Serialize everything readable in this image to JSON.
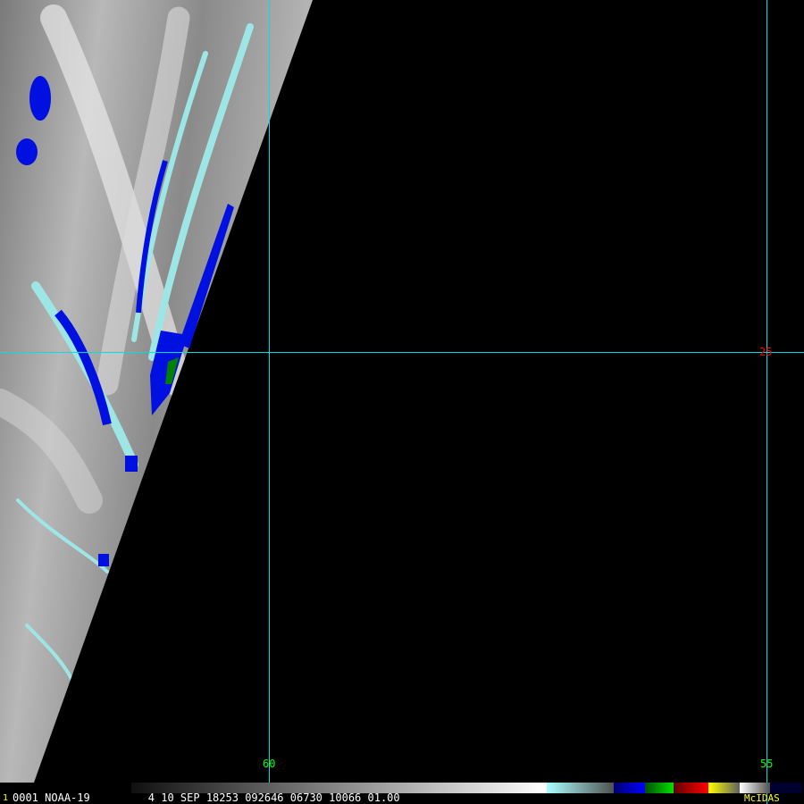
{
  "image": {
    "type": "satellite-imagery",
    "satellite": "NOAA-19",
    "frame_number": "1",
    "header_fields": [
      "0001",
      "NOAA-19",
      "4",
      "10",
      "SEP",
      "18253",
      "092646",
      "06730",
      "10066",
      "01.00"
    ],
    "software": "McIDAS"
  },
  "grid": {
    "longitude_labels": [
      "60",
      "55"
    ],
    "latitude_labels": [
      "25"
    ],
    "grid_color": "#00e0e0",
    "lon_label_color": "#00ff00",
    "lat_label_color": "#ff0000"
  },
  "colorbar": {
    "segments": [
      {
        "name": "gray-ramp",
        "colors": [
          "#101010",
          "#ffffff"
        ]
      },
      {
        "name": "cyan-ramp",
        "colors": [
          "#aaffff",
          "#505050"
        ]
      },
      {
        "name": "blue",
        "colors": [
          "#000070",
          "#0000ff"
        ]
      },
      {
        "name": "green",
        "colors": [
          "#005000",
          "#00e000"
        ]
      },
      {
        "name": "red",
        "colors": [
          "#600000",
          "#ff0000"
        ]
      },
      {
        "name": "yellow",
        "colors": [
          "#ffff00",
          "#606060"
        ]
      },
      {
        "name": "gray-dark",
        "colors": [
          "#ffffff",
          "#505050"
        ]
      },
      {
        "name": "navy",
        "colors": [
          "#000030",
          "#000030"
        ]
      }
    ]
  }
}
